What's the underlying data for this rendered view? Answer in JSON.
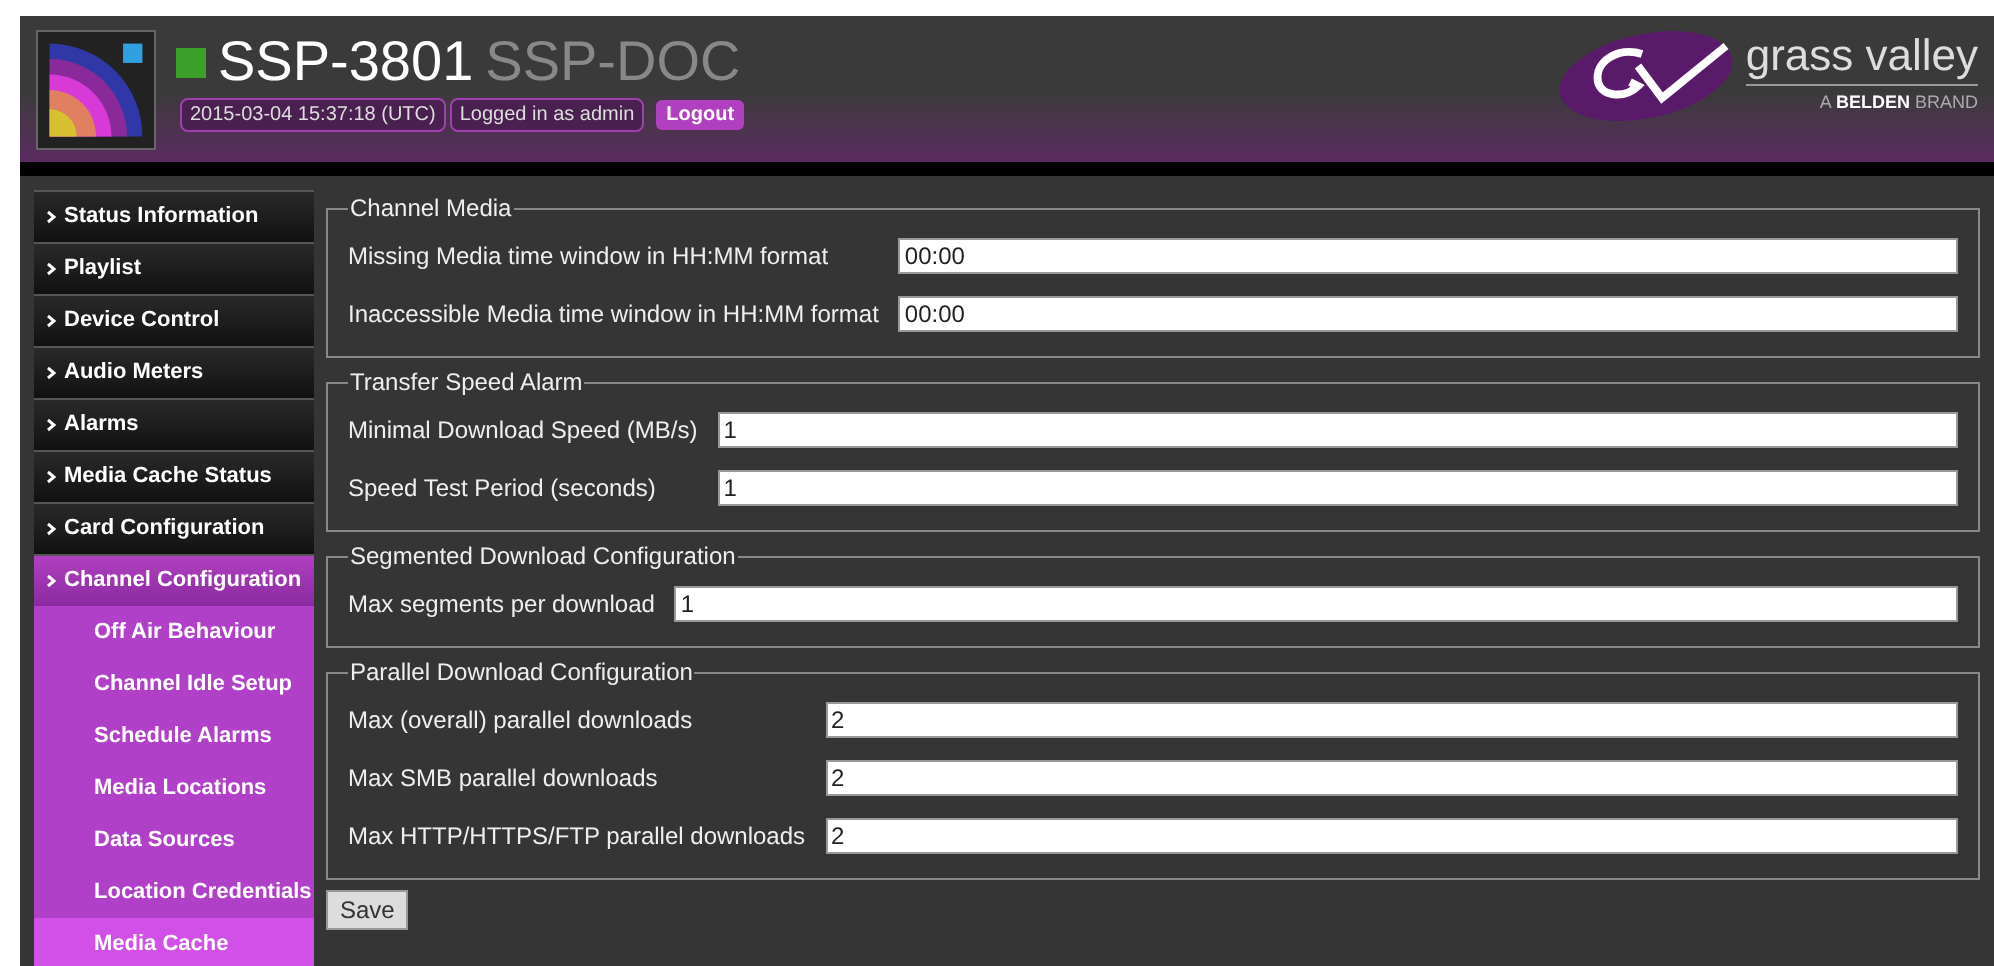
{
  "header": {
    "status_on": true,
    "device": "SSP-3801",
    "name": "SSP-DOC",
    "timestamp": "2015-03-04 15:37:18 (UTC)",
    "login": "Logged in as admin",
    "logout": "Logout",
    "brand": "grass valley",
    "brand_sub_prefix": "A",
    "brand_sub_bold": "BELDEN",
    "brand_sub_suffix": "BRAND"
  },
  "sidebar": {
    "items": [
      {
        "label": "Status Information",
        "expanded": false
      },
      {
        "label": "Playlist",
        "expanded": false
      },
      {
        "label": "Device Control",
        "expanded": false
      },
      {
        "label": "Audio Meters",
        "expanded": false
      },
      {
        "label": "Alarms",
        "expanded": false
      },
      {
        "label": "Media Cache Status",
        "expanded": false
      },
      {
        "label": "Card Configuration",
        "expanded": false
      },
      {
        "label": "Channel Configuration",
        "expanded": true,
        "children": [
          {
            "label": "Off Air Behaviour",
            "selected": false
          },
          {
            "label": "Channel Idle Setup",
            "selected": false
          },
          {
            "label": "Schedule Alarms",
            "selected": false
          },
          {
            "label": "Media Locations",
            "selected": false
          },
          {
            "label": "Data Sources",
            "selected": false
          },
          {
            "label": "Location Credentials",
            "selected": false
          },
          {
            "label": "Media Cache",
            "selected": true
          }
        ]
      }
    ]
  },
  "sections": [
    {
      "title": "Channel Media",
      "fields": [
        {
          "label": "Missing Media time window in HH:MM format",
          "value": "00:00"
        },
        {
          "label": "Inaccessible Media time window in HH:MM format",
          "value": "00:00"
        }
      ]
    },
    {
      "title": "Transfer Speed Alarm",
      "fields": [
        {
          "label": "Minimal Download Speed (MB/s)",
          "value": "1"
        },
        {
          "label": "Speed Test Period (seconds)",
          "value": "1"
        }
      ]
    },
    {
      "title": "Segmented Download Configuration",
      "fields": [
        {
          "label": "Max segments per download",
          "value": "1"
        }
      ]
    },
    {
      "title": "Parallel Download Configuration",
      "fields": [
        {
          "label": "Max (overall) parallel downloads",
          "value": "2"
        },
        {
          "label": "Max SMB parallel downloads",
          "value": "2"
        },
        {
          "label": "Max HTTP/HTTPS/FTP parallel downloads",
          "value": "2"
        }
      ]
    }
  ],
  "save": "Save"
}
